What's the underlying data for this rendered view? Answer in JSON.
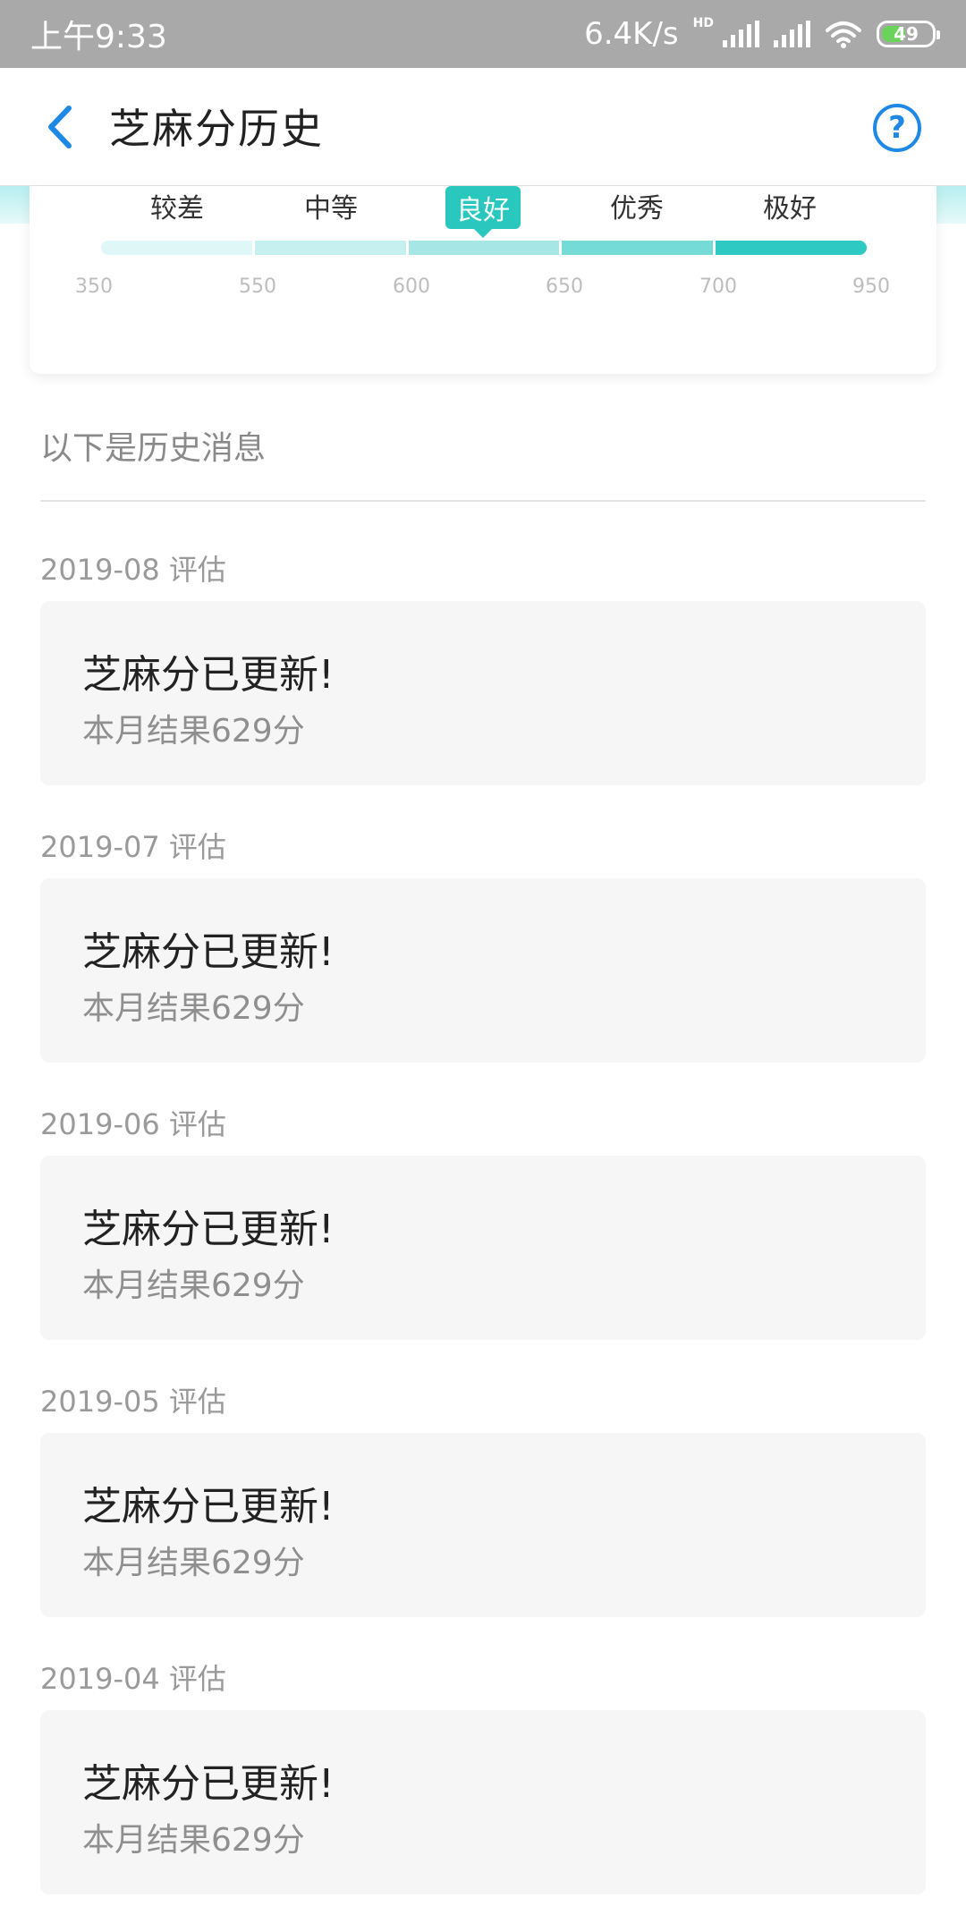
{
  "status_bar": {
    "time": "上午9:33",
    "speed": "6.4K/s",
    "hd": "HD",
    "battery": "49",
    "battery_level": 0.49
  },
  "nav": {
    "title": "芝麻分历史"
  },
  "score_scale": {
    "levels": [
      "较差",
      "中等",
      "良好",
      "优秀",
      "极好"
    ],
    "active_level": "良好",
    "ticks": [
      "350",
      "550",
      "600",
      "650",
      "700",
      "950"
    ],
    "colors": [
      "#dff7f7",
      "#c6f0f0",
      "#a6e7e6",
      "#74dbd7",
      "#2ec9c2"
    ],
    "accent_color": "#29c7bd"
  },
  "history": {
    "header": "以下是历史消息",
    "entries": [
      {
        "date": "2019-08 评估",
        "title": "芝麻分已更新!",
        "result": "本月结果629分"
      },
      {
        "date": "2019-07 评估",
        "title": "芝麻分已更新!",
        "result": "本月结果629分"
      },
      {
        "date": "2019-06 评估",
        "title": "芝麻分已更新!",
        "result": "本月结果629分"
      },
      {
        "date": "2019-05 评估",
        "title": "芝麻分已更新!",
        "result": "本月结果629分"
      },
      {
        "date": "2019-04 评估",
        "title": "芝麻分已更新!",
        "result": "本月结果629分"
      }
    ]
  },
  "icons": {
    "back": "chevron-left-icon",
    "help": "question-circle-icon"
  }
}
